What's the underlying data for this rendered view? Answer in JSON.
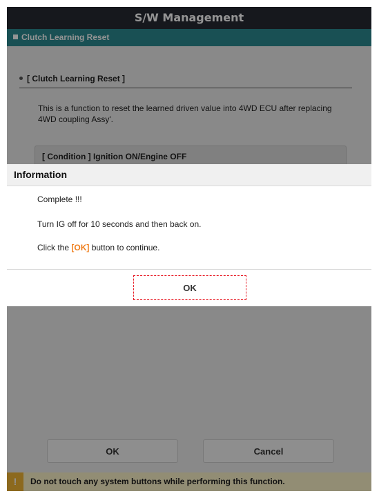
{
  "window": {
    "title": "S/W Management"
  },
  "subheader": {
    "label": "Clutch Learning Reset"
  },
  "section": {
    "title": "[ Clutch Learning Reset ]",
    "description": "This is a function to reset the learned driven value into 4WD ECU after replacing 4WD coupling Assy'.",
    "condition": "[ Condition ] Ignition ON/Engine OFF"
  },
  "dialog": {
    "title": "Information",
    "line1": "Complete !!!",
    "line2": "Turn IG off for 10 seconds and then back on.",
    "line3_prefix": "Click the ",
    "line3_highlight": "[OK]",
    "line3_suffix": " button to continue.",
    "ok_label": "OK"
  },
  "footer": {
    "ok_label": "OK",
    "cancel_label": "Cancel"
  },
  "warning": {
    "icon": "!",
    "text": "Do not touch any system buttons while performing this function."
  },
  "colors": {
    "header": "#262a33",
    "accent": "#2b8a91",
    "highlight": "#f07f1e",
    "warning_icon": "#f2b634",
    "warning_bg": "#fcf3c9"
  }
}
